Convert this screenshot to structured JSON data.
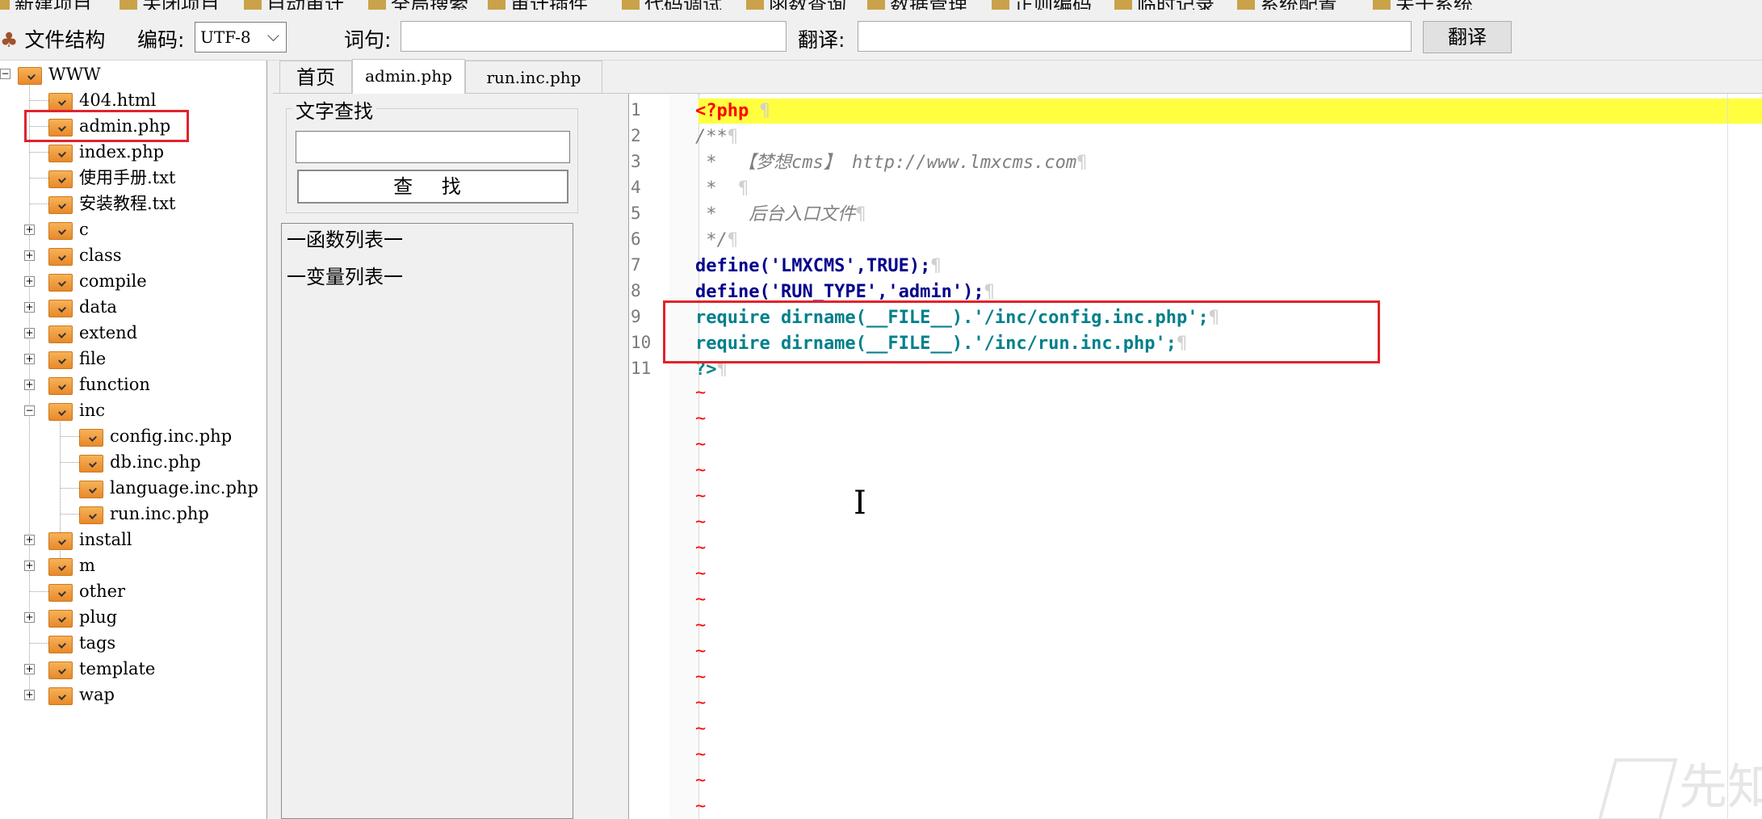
{
  "top_menu": [
    {
      "label": "新建项目"
    },
    {
      "label": "关闭项目"
    },
    {
      "label": "自动审计"
    },
    {
      "label": "全局搜索"
    },
    {
      "label": "审计插件"
    },
    {
      "label": "代码调试"
    },
    {
      "label": "函数查询"
    },
    {
      "label": "数据管理"
    },
    {
      "label": "正则编码"
    },
    {
      "label": "临时记录"
    },
    {
      "label": "系统配置"
    },
    {
      "label": "关于系统"
    }
  ],
  "toolbar": {
    "file_structure_label": "文件结构",
    "encoding_label": "编码:",
    "encoding_value": "UTF-8",
    "word_label": "词句:",
    "word_value": "",
    "translate_label": "翻译:",
    "translate_value": "",
    "translate_button": "翻译"
  },
  "tree": {
    "root": "WWW",
    "items": [
      {
        "label": "404.html",
        "depth": 1,
        "expandable": false
      },
      {
        "label": "admin.php",
        "depth": 1,
        "expandable": false,
        "highlighted": true
      },
      {
        "label": "index.php",
        "depth": 1,
        "expandable": false
      },
      {
        "label": "使用手册.txt",
        "depth": 1,
        "expandable": false
      },
      {
        "label": "安装教程.txt",
        "depth": 1,
        "expandable": false
      },
      {
        "label": "c",
        "depth": 1,
        "expandable": true,
        "expanded": false
      },
      {
        "label": "class",
        "depth": 1,
        "expandable": true,
        "expanded": false
      },
      {
        "label": "compile",
        "depth": 1,
        "expandable": true,
        "expanded": false
      },
      {
        "label": "data",
        "depth": 1,
        "expandable": true,
        "expanded": false
      },
      {
        "label": "extend",
        "depth": 1,
        "expandable": true,
        "expanded": false
      },
      {
        "label": "file",
        "depth": 1,
        "expandable": true,
        "expanded": false
      },
      {
        "label": "function",
        "depth": 1,
        "expandable": true,
        "expanded": false
      },
      {
        "label": "inc",
        "depth": 1,
        "expandable": true,
        "expanded": true
      },
      {
        "label": "config.inc.php",
        "depth": 2,
        "expandable": false
      },
      {
        "label": "db.inc.php",
        "depth": 2,
        "expandable": false
      },
      {
        "label": "language.inc.php",
        "depth": 2,
        "expandable": false
      },
      {
        "label": "run.inc.php",
        "depth": 2,
        "expandable": false
      },
      {
        "label": "install",
        "depth": 1,
        "expandable": true,
        "expanded": false
      },
      {
        "label": "m",
        "depth": 1,
        "expandable": true,
        "expanded": false
      },
      {
        "label": "other",
        "depth": 1,
        "expandable": false
      },
      {
        "label": "plug",
        "depth": 1,
        "expandable": true,
        "expanded": false
      },
      {
        "label": "tags",
        "depth": 1,
        "expandable": false
      },
      {
        "label": "template",
        "depth": 1,
        "expandable": true,
        "expanded": false
      },
      {
        "label": "wap",
        "depth": 1,
        "expandable": true,
        "expanded": false
      }
    ]
  },
  "tabs": [
    {
      "label": "首页",
      "active": false
    },
    {
      "label": "admin.php",
      "active": true
    },
    {
      "label": "run.inc.php",
      "active": false
    }
  ],
  "find_panel": {
    "title": "文字查找",
    "input_value": "",
    "button": "查 找",
    "function_list": "一函数列表一",
    "variable_list": "一变量列表一"
  },
  "editor": {
    "line_numbers": [
      "1",
      "2",
      "3",
      "4",
      "5",
      "6",
      "7",
      "8",
      "9",
      "10",
      "11"
    ],
    "lines": [
      "<?php ",
      "/**",
      " *  【梦想cms】 http://www.lmxcms.com",
      " *  ",
      " *   后台入口文件",
      " */",
      "define('LMXCMS',TRUE);",
      "define('RUN_TYPE','admin');",
      "require dirname(__FILE__).'/inc/config.inc.php';",
      "require dirname(__FILE__).'/inc/run.inc.php';",
      "?>"
    ],
    "empty_line_marker": "~",
    "empty_line_count": 17
  },
  "watermark": "先知社区",
  "colors": {
    "current_line": "#ffff40",
    "annotation_box": "#e0242b",
    "keyword": "#00008b",
    "string": "#ff00ff",
    "comment": "#808080",
    "tilde": "#ff0000"
  }
}
